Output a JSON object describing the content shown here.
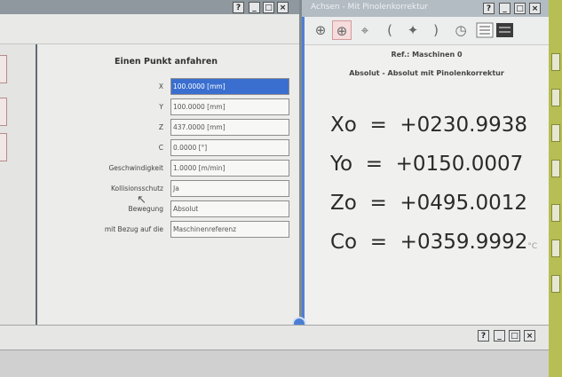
{
  "left_window": {
    "title_buttons": [
      "?",
      "_",
      "□",
      "×"
    ],
    "panel": {
      "heading": "Einen Punkt anfahren",
      "fields": [
        {
          "label": "X",
          "value": "100.0000 [mm]"
        },
        {
          "label": "Y",
          "value": "100.0000 [mm]"
        },
        {
          "label": "Z",
          "value": "437.0000 [mm]"
        },
        {
          "label": "C",
          "value": "0.0000 [°]"
        },
        {
          "label": "Geschwindigkeit",
          "value": "1.0000 [m/min]"
        },
        {
          "label": "Kollisionsschutz",
          "value": "Ja"
        },
        {
          "label": "Bewegung",
          "value": "Absolut"
        },
        {
          "label": "mit Bezug auf die",
          "value": "Maschinenreferenz"
        }
      ]
    }
  },
  "right_window": {
    "title": "Achsen - Mit Pinolenkorrektur",
    "title_buttons": [
      "?",
      "_",
      "□",
      "×"
    ],
    "toolbar_icons": [
      "crosshair-icon",
      "crosshair-active-icon",
      "target-icon",
      "left-paren-icon",
      "sparkle-icon",
      "right-paren-icon",
      "clock-icon",
      "mode-grid-icon"
    ],
    "ref_line": "Ref.: Maschinen 0",
    "mode_line": "Absolut - Absolut mit Pinolenkorrektur",
    "readouts": [
      {
        "axis": "Xo",
        "eq": "=",
        "value": "+0230.9938"
      },
      {
        "axis": "Yo",
        "eq": "=",
        "value": "+0150.0007"
      },
      {
        "axis": "Zo",
        "eq": "=",
        "value": "+0495.0012"
      },
      {
        "axis": "Co",
        "eq": "=",
        "value": "+0359.9992",
        "suffix": "°C"
      }
    ]
  },
  "bottom_window": {
    "title_buttons": [
      "?",
      "_",
      "□",
      "×"
    ]
  },
  "colors": {
    "accent": "#4f7fd6",
    "selection": "#3a6fd0",
    "side_panel": "#b7be53"
  }
}
